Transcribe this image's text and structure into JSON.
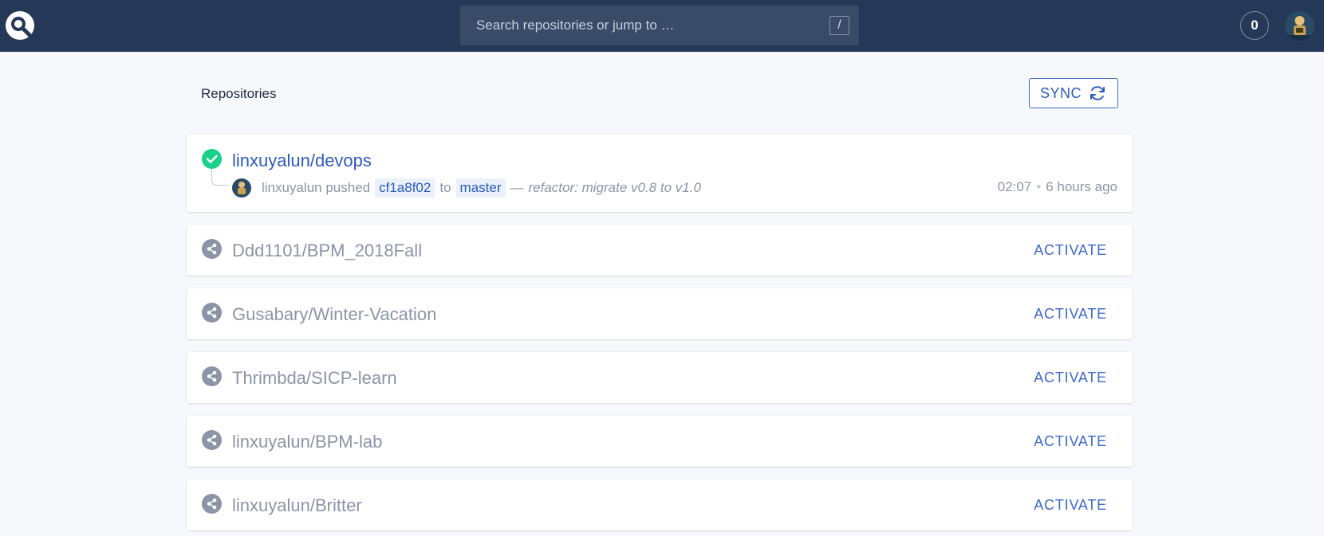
{
  "header": {
    "search": {
      "placeholder": "Search repositories or jump to …",
      "shortcut": "/"
    },
    "notifications_count": "0"
  },
  "main": {
    "title": "Repositories",
    "sync_label": "SYNC"
  },
  "repos": [
    {
      "name": "linxuyalun/devops",
      "status": "success",
      "commit": {
        "author": "linxuyalun",
        "action": "pushed",
        "sha": "cf1a8f02",
        "to": "to",
        "branch": "master",
        "dash": "—",
        "message": "refactor: migrate v0.8 to v1.0",
        "time": "02:07",
        "dot": "•",
        "ago": "6 hours ago"
      }
    },
    {
      "name": "Ddd1101/BPM_2018Fall",
      "status": "inactive",
      "action": "ACTIVATE"
    },
    {
      "name": "Gusabary/Winter-Vacation",
      "status": "inactive",
      "action": "ACTIVATE"
    },
    {
      "name": "Thrimbda/SICP-learn",
      "status": "inactive",
      "action": "ACTIVATE"
    },
    {
      "name": "linxuyalun/BPM-lab",
      "status": "inactive",
      "action": "ACTIVATE"
    },
    {
      "name": "linxuyalun/Britter",
      "status": "inactive",
      "action": "ACTIVATE"
    }
  ],
  "colors": {
    "header_bg": "#253858",
    "accent": "#2d5bc0",
    "success": "#19d18a",
    "inactive_icon": "#8b95a7"
  },
  "icons": {
    "logo": "drone-logo-icon",
    "success": "check-circle-icon",
    "inactive": "share-icon",
    "sync": "refresh-icon"
  }
}
